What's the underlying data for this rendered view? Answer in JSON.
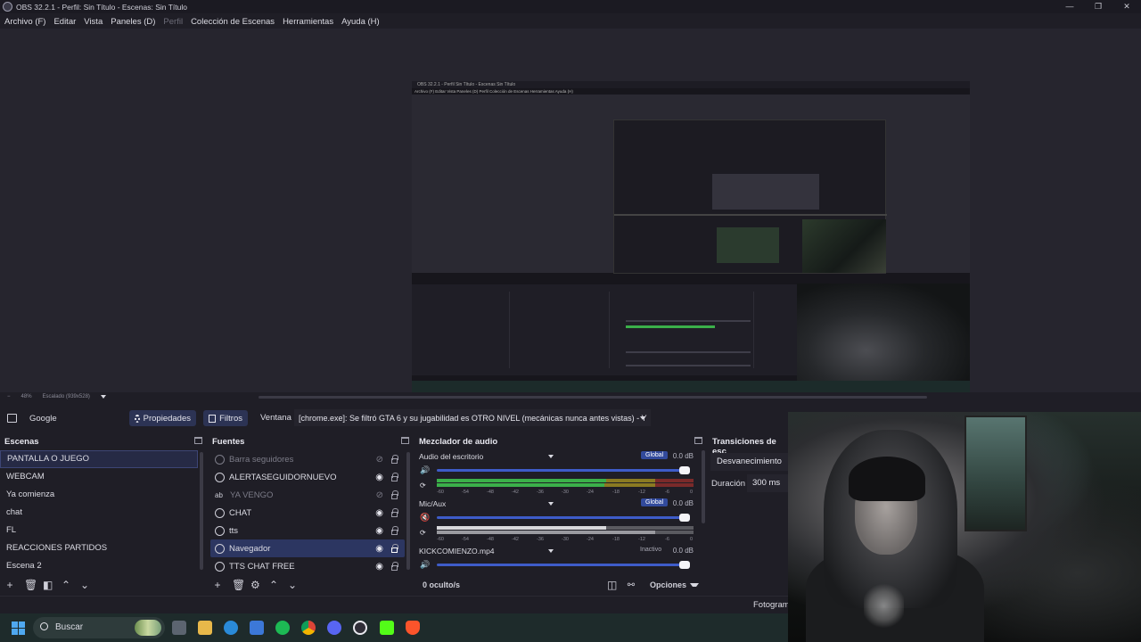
{
  "window": {
    "title": "OBS 32.2.1 - Perfil: Sin Título - Escenas: Sin Título",
    "controls": [
      "—",
      "❐",
      "✕"
    ]
  },
  "menu": [
    {
      "label": "Archivo (F)",
      "enabled": true
    },
    {
      "label": "Editar",
      "enabled": true
    },
    {
      "label": "Vista",
      "enabled": true
    },
    {
      "label": "Paneles (D)",
      "enabled": true
    },
    {
      "label": "Perfil",
      "enabled": false
    },
    {
      "label": "Colección de Escenas",
      "enabled": true
    },
    {
      "label": "Herramientas",
      "enabled": true
    },
    {
      "label": "Ayuda (H)",
      "enabled": true
    }
  ],
  "preview_status": {
    "zoom": "48%",
    "scaling": "Escalado (939x528)"
  },
  "source_toolbar": {
    "source_name": "Google",
    "properties": "Propiedades",
    "filters": "Filtros",
    "window_label": "Ventana",
    "window_value": "[chrome.exe]: Se filtró GTA 6 y su jugabilidad es OTRO NIVEL (mecánicas nunca antes vistas) - Y"
  },
  "scenes": {
    "title": "Escenas",
    "items": [
      "PANTALLA O JUEGO",
      "WEBCAM",
      "Ya comienza",
      "chat",
      "FL",
      "REACCIONES PARTIDOS",
      "Escena 2"
    ],
    "selected": "PANTALLA O JUEGO"
  },
  "sources": {
    "title": "Fuentes",
    "items": [
      {
        "name": "Barra seguidores",
        "type": "browser",
        "visible": false
      },
      {
        "name": "ALERTASEGUIDORNUEVO",
        "type": "browser",
        "visible": true
      },
      {
        "name": "YA VENGO",
        "type": "text",
        "visible": false
      },
      {
        "name": "CHAT",
        "type": "browser",
        "visible": true
      },
      {
        "name": "tts",
        "type": "browser",
        "visible": true
      },
      {
        "name": "Navegador",
        "type": "browser",
        "visible": true
      },
      {
        "name": "TTS CHAT FREE",
        "type": "browser",
        "visible": true
      }
    ],
    "selected": "Navegador"
  },
  "mixer": {
    "title": "Mezclador de audio",
    "tracks": [
      {
        "name": "Audio del escritorio",
        "db": "0.0 dB",
        "badge": "Global"
      },
      {
        "name": "Mic/Aux",
        "db": "0.0 dB",
        "badge": "Global",
        "muted": true
      },
      {
        "name": "KICKCOMIENZO.mp4",
        "db": "0.0 dB",
        "badge": "Inactivo"
      }
    ],
    "scale": [
      "-60",
      "-54",
      "-48",
      "-42",
      "-36",
      "-30",
      "-24",
      "-18",
      "-12",
      "-6",
      "0"
    ],
    "hidden": "0 oculto/s",
    "options": "Opciones"
  },
  "transitions": {
    "title": "Transiciones de esc",
    "type": "Desvanecimiento",
    "duration_label": "Duración",
    "duration": "300 ms"
  },
  "statusbar": {
    "fps": "Fotogram"
  },
  "nested_preview": {
    "title": "OBS 32.2.1 - Perfil Sin Título - Escenas Sin Título",
    "menu": "Archivo (F)  Editar  Vista  Paneles (D)  Perfil  Colección de Escenas  Herramientas  Ayuda (H)"
  },
  "taskbar": {
    "search_placeholder": "Buscar",
    "apps": [
      "task-view",
      "file-explorer",
      "edge",
      "store",
      "spotify",
      "chrome",
      "discord",
      "obs",
      "kick",
      "brave"
    ]
  },
  "colors": {
    "accent": "#3e5cc9",
    "selected_source": "#2c3661",
    "meter_green": "#3bb04a",
    "meter_yellow": "#c8a52a",
    "meter_red": "#c93a3a",
    "background": "#1f1e26"
  }
}
